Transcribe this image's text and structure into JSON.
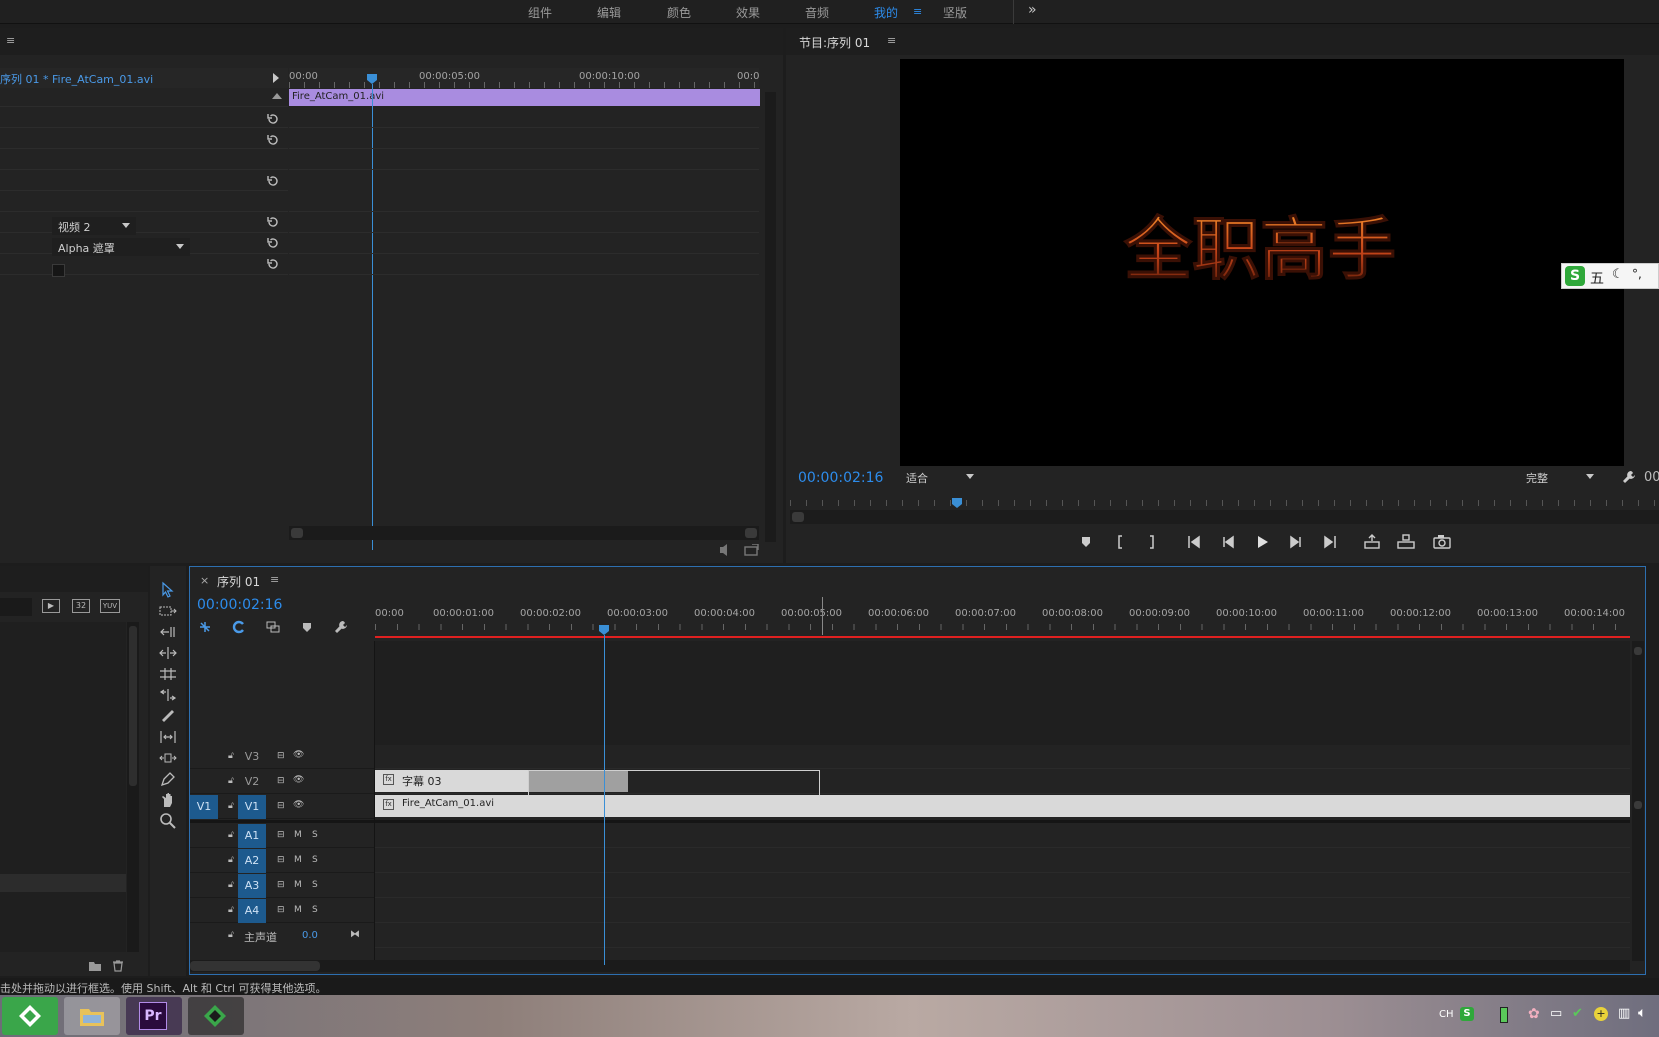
{
  "workspaces": [
    "组件",
    "编辑",
    "颜色",
    "效果",
    "音频",
    "我的",
    "坚版"
  ],
  "workspace_active": "我的",
  "effect_controls": {
    "clip_path": "序列 01 * Fire_AtCam_01.avi",
    "ruler": [
      "00:00",
      "00:00:05:00",
      "00:00:10:00",
      "00:0"
    ],
    "clip_name": "Fire_AtCam_01.avi",
    "track_select": "视频 2",
    "mode_select": "Alpha 遮罩"
  },
  "program_monitor": {
    "title": "节目:序列 01",
    "timecode": "00:00:02:16",
    "fit": "适合",
    "quality": "完整",
    "title_text": "全职高手",
    "right_tc_partial": "00"
  },
  "ime": {
    "label": "五",
    "extra": "°,"
  },
  "timeline": {
    "tab_title": "序列 01",
    "timecode": "00:00:02:16",
    "ruler": [
      "00:00",
      "00:00:01:00",
      "00:00:02:00",
      "00:00:03:00",
      "00:00:04:00",
      "00:00:05:00",
      "00:00:06:00",
      "00:00:07:00",
      "00:00:08:00",
      "00:00:09:00",
      "00:00:10:00",
      "00:00:11:00",
      "00:00:12:00",
      "00:00:13:00",
      "00:00:14:00"
    ],
    "video_tracks": [
      "V3",
      "V2",
      "V1"
    ],
    "v1_source": "V1",
    "audio_tracks": [
      "A1",
      "A2",
      "A3",
      "A4"
    ],
    "mute_label": "M",
    "solo_label": "S",
    "master_label": "主声道",
    "master_value": "0.0",
    "clip_title": "字幕 03",
    "clip_video": "Fire_AtCam_01.avi"
  },
  "project": {
    "icons_text": [
      "32",
      "YUV"
    ]
  },
  "status_bar": "击处并拖动以进行框选。使用 Shift、Alt 和 Ctrl 可获得其他选项。",
  "taskbar": {
    "premiere_label": "Pr",
    "tray_lang": "CH"
  },
  "colors": {
    "accent_blue": "#2d8ceb",
    "clip_purple": "#a98ce0",
    "playhead": "#3a8fd6",
    "work_area_red": "#e02020"
  }
}
